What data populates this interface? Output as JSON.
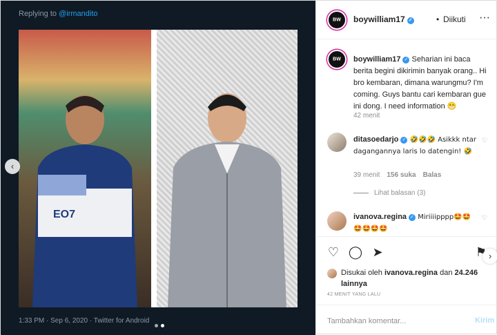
{
  "tweet": {
    "replying_prefix": "Replying to ",
    "replying_mention": "@irmandito",
    "meta": "1:33 PM · Sep 6, 2020 · Twitter for Android"
  },
  "header": {
    "username": "boywilliam17",
    "verified_mark": "✓",
    "separator": "•",
    "follow_status": "Diikuti",
    "more": "···"
  },
  "caption": {
    "username": "boywilliam17",
    "text": " Seharian ini baca berita begini dikirimin banyak orang.. Hi bro kembaran, dimana warungmu? I'm coming. Guys bantu cari kembaran gue ini dong. I need information 😁",
    "time": "42 menit"
  },
  "comments": [
    {
      "username": "ditasoedarjo",
      "text": " 🤣🤣🤣 Asikkk ntar dagangannya laris lo datengin! 🤣",
      "time": "39 menit",
      "likes": "156 suka",
      "reply": "Balas",
      "view_replies": "Lihat balasan (3)"
    },
    {
      "username": "ivanova.regina",
      "text": " Miriiiipppp🤩🤩🤩🤩🤩🤩"
    }
  ],
  "avatar_tag": "BW",
  "liked": {
    "prefix": "Disukai oleh ",
    "user": "ivanova.regina",
    "and": " dan ",
    "count": "24.246 lainnya"
  },
  "time_ago": "42 MENIT YANG LALU",
  "add_comment": {
    "placeholder": "Tambahkan komentar...",
    "post": "Kirim"
  },
  "icons": {
    "nav_left": "‹",
    "nav_right": "›",
    "small_heart": "♡",
    "like": "♡",
    "comment": "◯",
    "share": "➤",
    "save": "⚑"
  }
}
